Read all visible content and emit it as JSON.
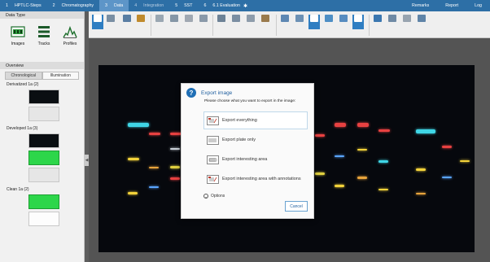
{
  "tabs": [
    {
      "num": "1",
      "label": "HPTLC-Steps",
      "state": "normal"
    },
    {
      "num": "2",
      "label": "Chromatography",
      "state": "normal"
    },
    {
      "num": "3",
      "label": "Data",
      "state": "active"
    },
    {
      "num": "4",
      "label": "Integration",
      "state": "faded"
    },
    {
      "num": "5",
      "label": "SST",
      "state": "normal"
    },
    {
      "num": "6",
      "label": "6.1 Evaluation",
      "state": "normal"
    }
  ],
  "topbar": {
    "remarks": "Remarks",
    "report": "Report",
    "log": "Log",
    "add_icon": "star-icon"
  },
  "left": {
    "data_type_header": "Data Type",
    "data_types": [
      "Images",
      "Tracks",
      "Profiles"
    ],
    "overview_header": "Overview",
    "toggle": [
      "Chronological",
      "Illumination"
    ],
    "groups": [
      {
        "label": "Derivatized 1a (2)"
      },
      {
        "label": "Developed 1a (3)"
      },
      {
        "label": "Clean 1a (2)"
      }
    ],
    "collapse_glyph": "◀"
  },
  "dialog": {
    "title": "Export image",
    "help_glyph": "?",
    "prompt": "Please choose what you want to export in the image:",
    "options": [
      "Export everything",
      "Export plate only",
      "Export interesting area",
      "Export interesting area with annotations"
    ],
    "options_toggle": "Options",
    "chevron_glyph": "⌄",
    "cancel": "Cancel"
  },
  "colors": {
    "accent": "#2d6fa6",
    "plate_bg": "#06080d",
    "dialog_title": "#1f5f9f"
  }
}
